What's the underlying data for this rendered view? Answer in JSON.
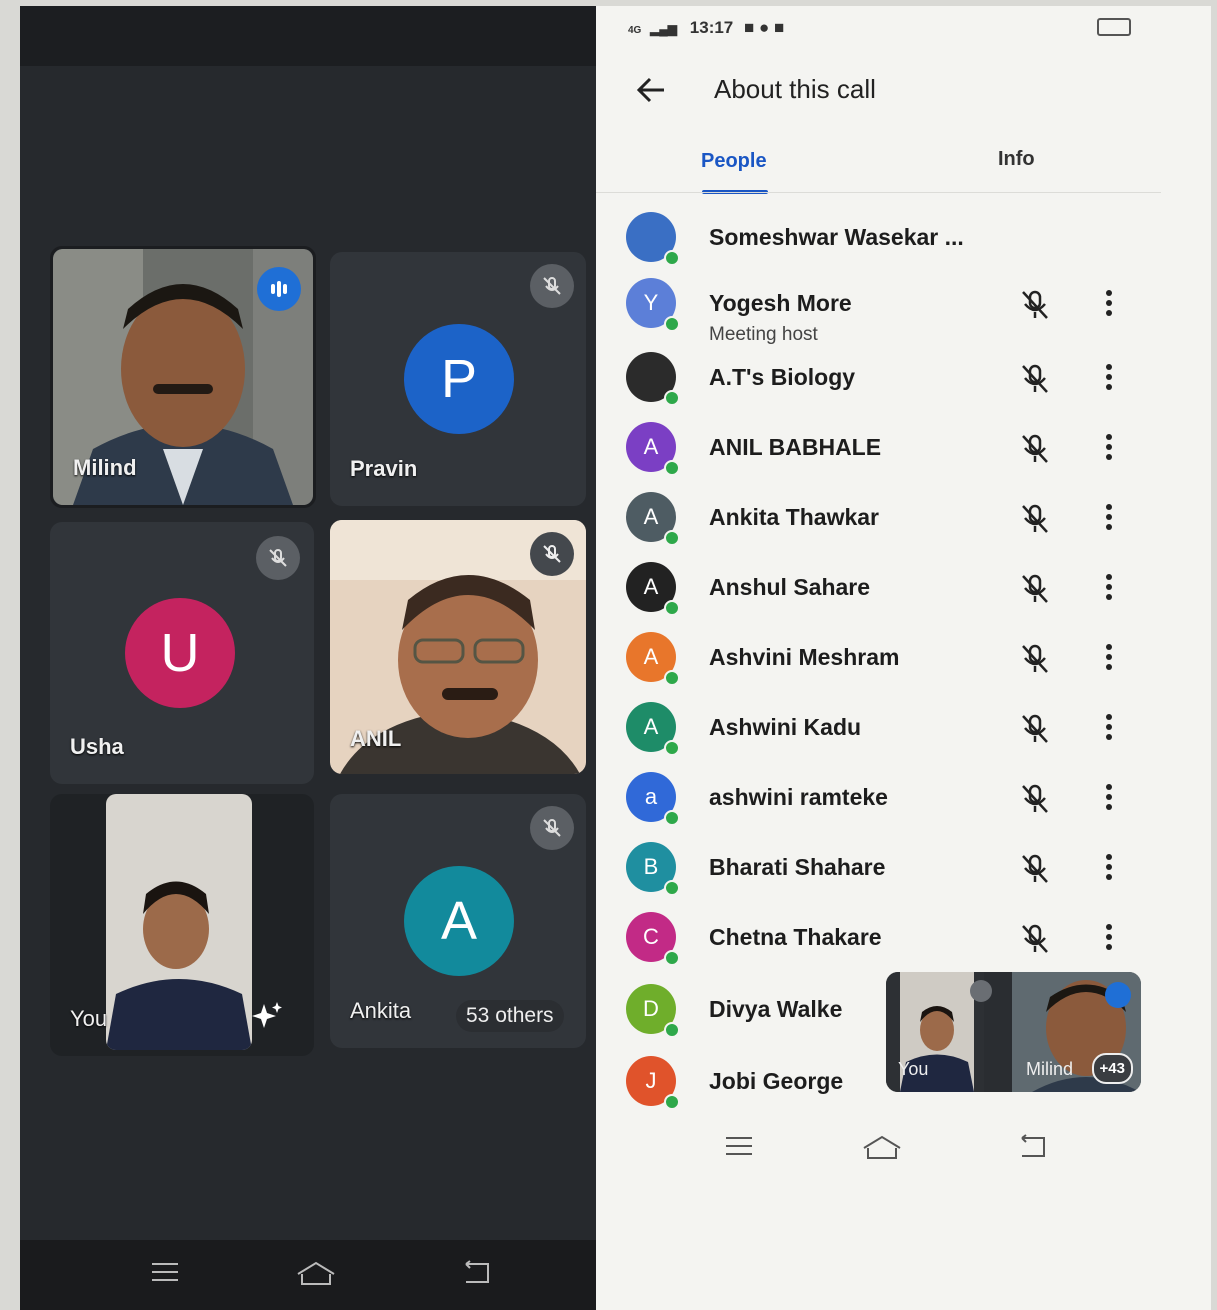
{
  "left": {
    "tiles": [
      {
        "name": "Milind"
      },
      {
        "name": "Pravin",
        "initial": "P"
      },
      {
        "name": "Usha",
        "initial": "U"
      },
      {
        "name": "ANIL"
      },
      {
        "name": "You"
      },
      {
        "name": "Ankita",
        "initial": "A",
        "others": "53 others"
      }
    ]
  },
  "right": {
    "status": {
      "time": "13:17",
      "signal": "4G"
    },
    "header": {
      "title": "About this call"
    },
    "tabs": [
      {
        "label": "People"
      },
      {
        "label": "Info"
      }
    ],
    "people": [
      {
        "name": "Someshwar Wasekar ...",
        "initial": "",
        "color": "#3a6fc4"
      },
      {
        "name": "Yogesh More",
        "subtitle": "Meeting host",
        "initial": "Y",
        "color": "#5c7fd8"
      },
      {
        "name": "A.T's Biology",
        "initial": "",
        "color": "#2b2b2b"
      },
      {
        "name": "ANIL BABHALE",
        "initial": "A",
        "color": "#7b3fc4"
      },
      {
        "name": "Ankita Thawkar",
        "initial": "A",
        "color": "#4e5c63"
      },
      {
        "name": "Anshul Sahare",
        "initial": "A",
        "color": "#222222"
      },
      {
        "name": "Ashvini Meshram",
        "initial": "A",
        "color": "#e8762b"
      },
      {
        "name": "Ashwini Kadu",
        "initial": "A",
        "color": "#1e8c68"
      },
      {
        "name": "ashwini ramteke",
        "initial": "a",
        "color": "#3069d8"
      },
      {
        "name": "Bharati Shahare",
        "initial": "B",
        "color": "#1f8fa0"
      },
      {
        "name": "Chetna Thakare",
        "initial": "C",
        "color": "#c22a86"
      },
      {
        "name": "Divya Walke",
        "initial": "D",
        "color": "#6fae2b"
      },
      {
        "name": "Jobi George",
        "initial": "J",
        "color": "#e0532b"
      }
    ],
    "pip": {
      "you": "You",
      "milind": "Milind",
      "count": "+43"
    }
  }
}
